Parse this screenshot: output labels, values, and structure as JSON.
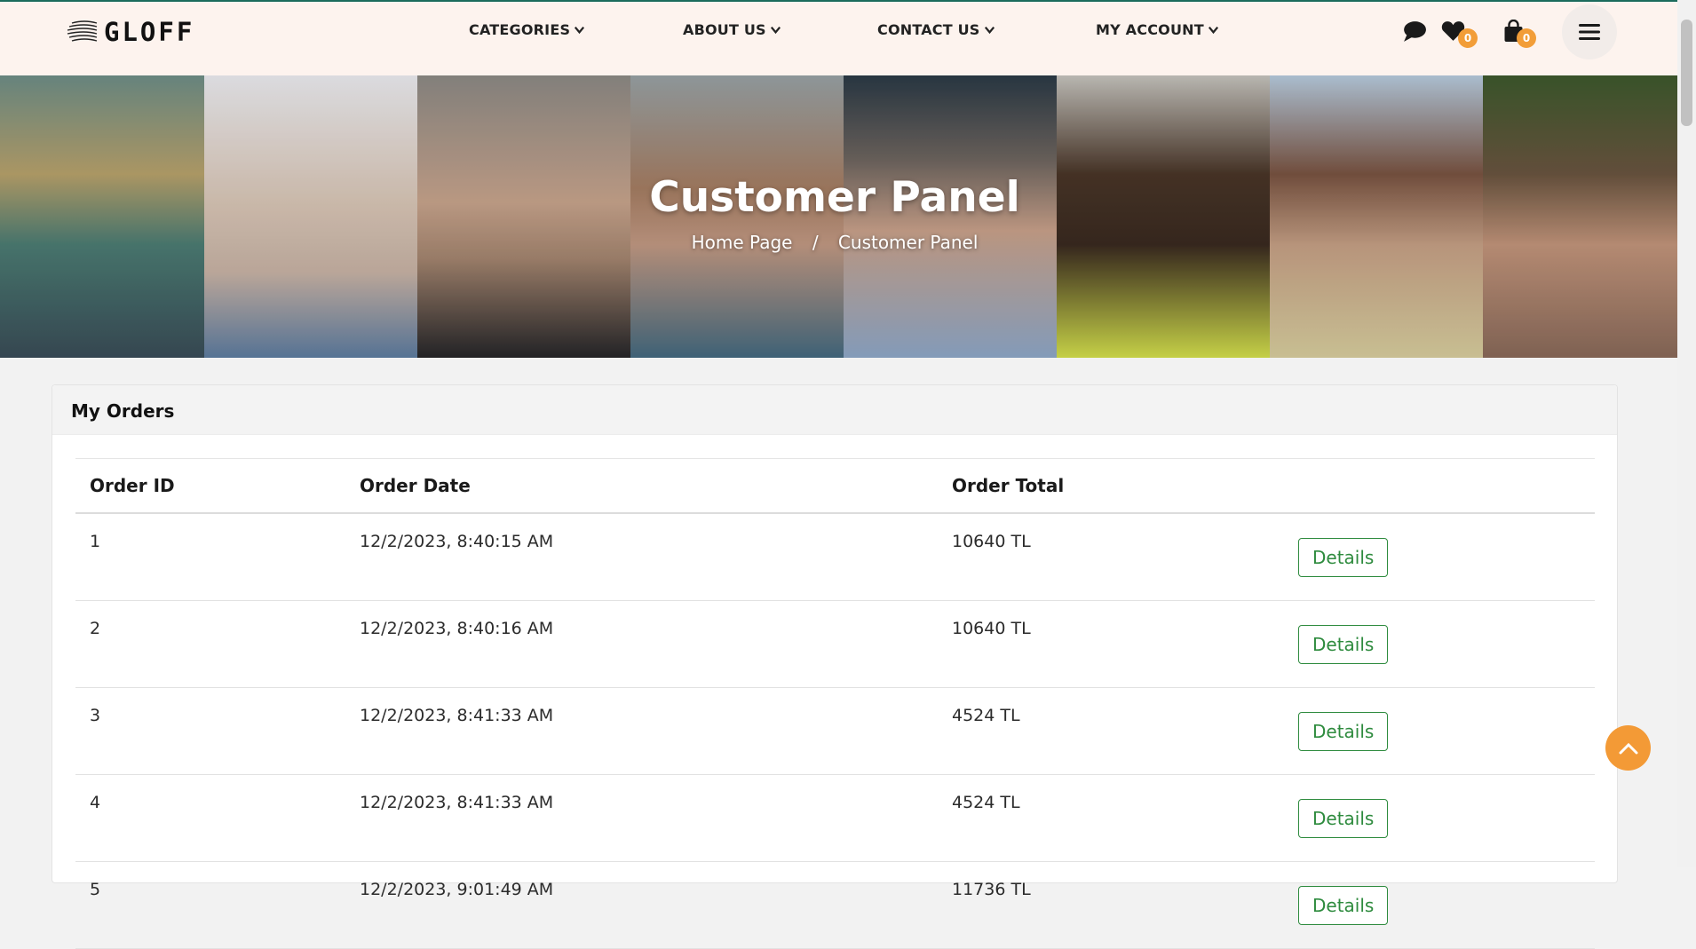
{
  "header": {
    "logo_text": "GLOFF",
    "nav": [
      {
        "label": "CATEGORIES"
      },
      {
        "label": "ABOUT US"
      },
      {
        "label": "CONTACT US"
      },
      {
        "label": "MY ACCOUNT"
      }
    ],
    "wishlist_count": "0",
    "cart_count": "0",
    "icons": [
      "chat-icon",
      "heart-icon",
      "shopping-bag-icon",
      "menu-icon",
      "chevron-down-icon"
    ]
  },
  "hero": {
    "title": "Customer Panel",
    "breadcrumb": {
      "home": "Home Page",
      "separator": "/",
      "current": "Customer Panel"
    }
  },
  "orders": {
    "title": "My Orders",
    "columns": [
      "Order ID",
      "Order Date",
      "Order Total",
      ""
    ],
    "rows": [
      {
        "id": "1",
        "date": "12/2/2023, 8:40:15 AM",
        "total": "10640 TL",
        "action": "Details"
      },
      {
        "id": "2",
        "date": "12/2/2023, 8:40:16 AM",
        "total": "10640 TL",
        "action": "Details"
      },
      {
        "id": "3",
        "date": "12/2/2023, 8:41:33 AM",
        "total": "4524 TL",
        "action": "Details"
      },
      {
        "id": "4",
        "date": "12/2/2023, 8:41:33 AM",
        "total": "4524 TL",
        "action": "Details"
      },
      {
        "id": "5",
        "date": "12/2/2023, 9:01:49 AM",
        "total": "11736 TL",
        "action": "Details"
      }
    ]
  },
  "colors": {
    "accent": "#f29d38",
    "details_green": "#2e8b3e",
    "header_bg": "#fdf3ee"
  }
}
